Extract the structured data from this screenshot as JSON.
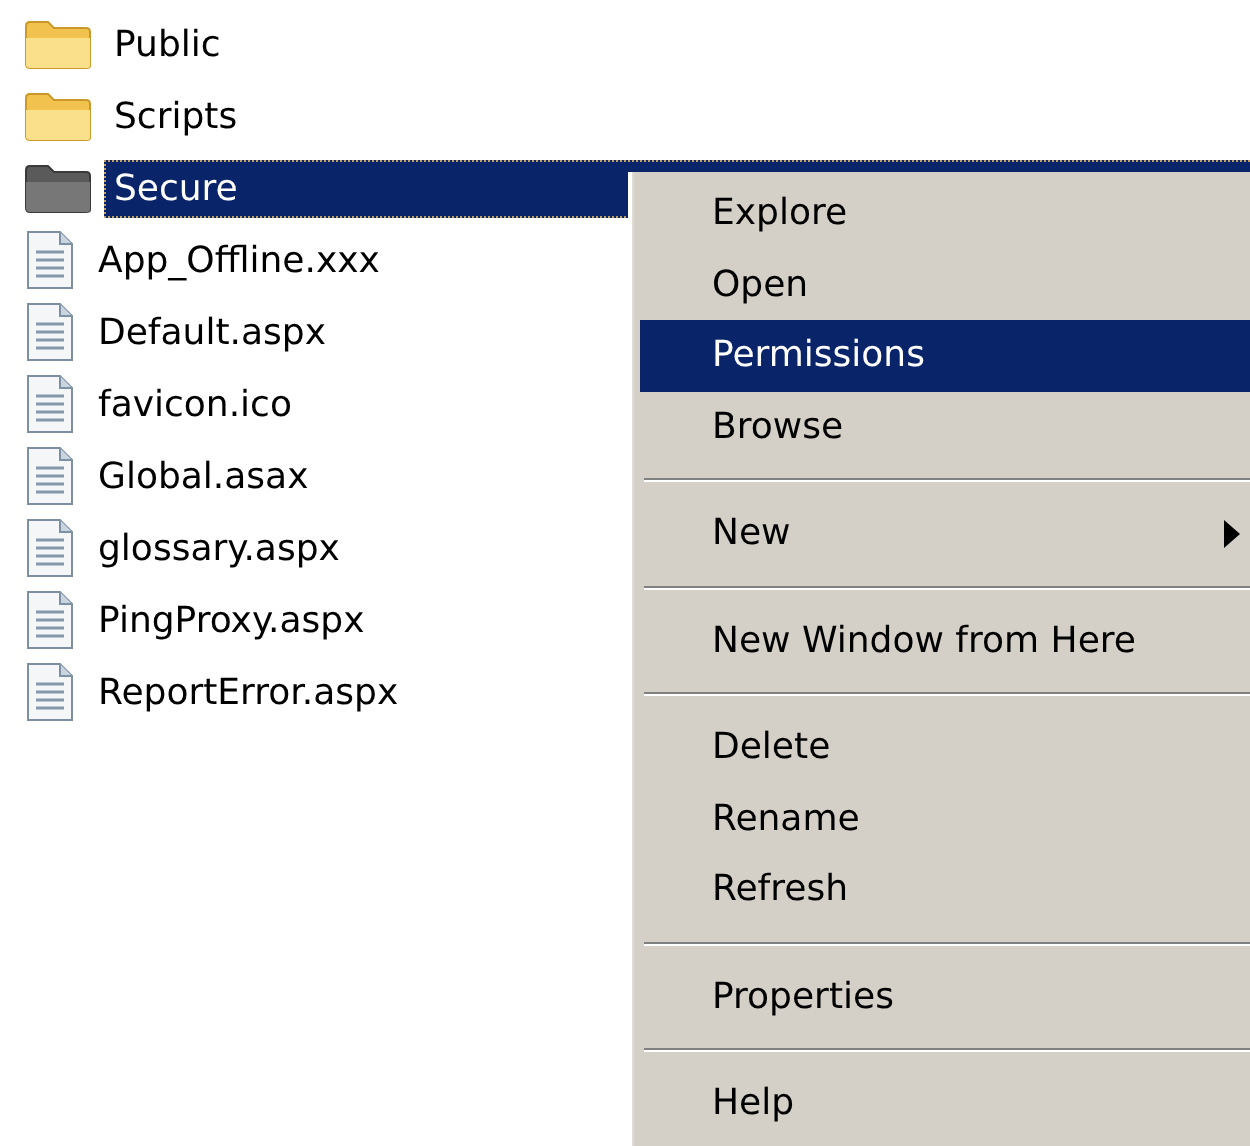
{
  "tree": [
    {
      "kind": "folder",
      "label": "Public",
      "selected": false
    },
    {
      "kind": "folder",
      "label": "Scripts",
      "selected": false
    },
    {
      "kind": "folder",
      "label": "Secure",
      "selected": true
    },
    {
      "kind": "file",
      "label": "App_Offline.xxx",
      "selected": false
    },
    {
      "kind": "file",
      "label": "Default.aspx",
      "selected": false
    },
    {
      "kind": "file",
      "label": "favicon.ico",
      "selected": false
    },
    {
      "kind": "file",
      "label": "Global.asax",
      "selected": false
    },
    {
      "kind": "file",
      "label": "glossary.aspx",
      "selected": false
    },
    {
      "kind": "file",
      "label": "PingProxy.aspx",
      "selected": false
    },
    {
      "kind": "file",
      "label": "ReportError.aspx",
      "selected": false
    }
  ],
  "context_menu": [
    {
      "kind": "item",
      "label": "Explore",
      "selected": false,
      "has_submenu": false
    },
    {
      "kind": "item",
      "label": "Open",
      "selected": false,
      "has_submenu": false
    },
    {
      "kind": "item",
      "label": "Permissions",
      "selected": true,
      "has_submenu": false
    },
    {
      "kind": "item",
      "label": "Browse",
      "selected": false,
      "has_submenu": false
    },
    {
      "kind": "separator"
    },
    {
      "kind": "item",
      "label": "New",
      "selected": false,
      "has_submenu": true
    },
    {
      "kind": "separator"
    },
    {
      "kind": "item",
      "label": "New Window from Here",
      "selected": false,
      "has_submenu": false
    },
    {
      "kind": "separator"
    },
    {
      "kind": "item",
      "label": "Delete",
      "selected": false,
      "has_submenu": false
    },
    {
      "kind": "item",
      "label": "Rename",
      "selected": false,
      "has_submenu": false
    },
    {
      "kind": "item",
      "label": "Refresh",
      "selected": false,
      "has_submenu": false
    },
    {
      "kind": "separator"
    },
    {
      "kind": "item",
      "label": "Properties",
      "selected": false,
      "has_submenu": false
    },
    {
      "kind": "separator"
    },
    {
      "kind": "item",
      "label": "Help",
      "selected": false,
      "has_submenu": false
    }
  ]
}
